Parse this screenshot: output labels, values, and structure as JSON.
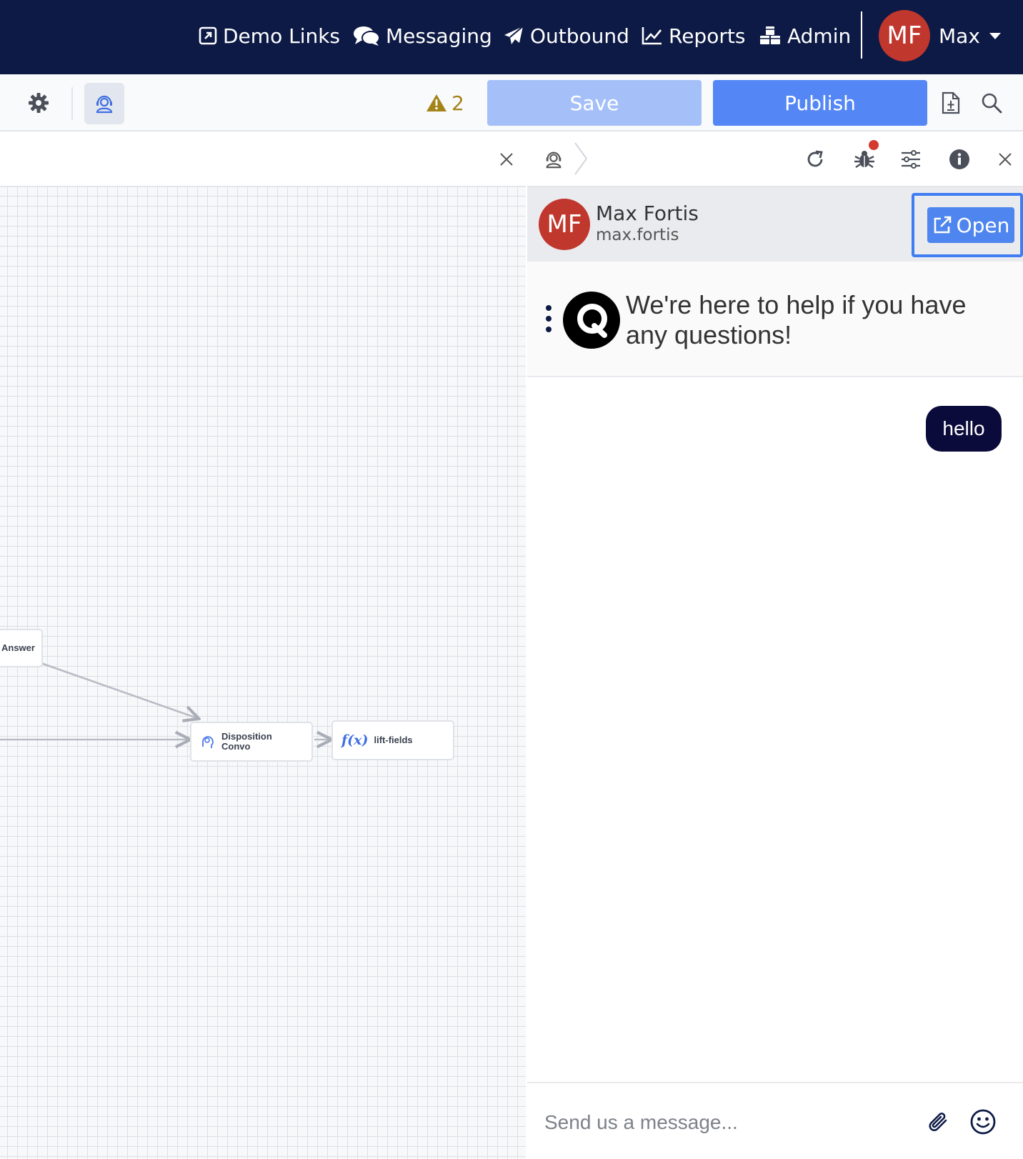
{
  "nav": {
    "items": [
      {
        "label": "Demo Links",
        "icon": "external-link-square-icon"
      },
      {
        "label": "Messaging",
        "icon": "comments-icon"
      },
      {
        "label": "Outbound",
        "icon": "paper-plane-icon"
      },
      {
        "label": "Reports",
        "icon": "line-chart-icon"
      },
      {
        "label": "Admin",
        "icon": "cubes-icon"
      }
    ],
    "avatar_initials": "MF",
    "user_label": "Max"
  },
  "toolbar": {
    "warning_count": "2",
    "save_label": "Save",
    "publish_label": "Publish"
  },
  "canvas": {
    "nodes": [
      {
        "label": "Answer"
      },
      {
        "label_line1": "Disposition",
        "label_line2": "Convo"
      },
      {
        "label": "lift-fields"
      }
    ]
  },
  "chat": {
    "user": {
      "initials": "MF",
      "name": "Max Fortis",
      "handle": "max.fortis"
    },
    "open_label": "Open",
    "welcome_text": "We're here to help if you have any questions!",
    "messages": [
      {
        "from": "user",
        "text": "hello"
      }
    ],
    "composer_placeholder": "Send us a message..."
  },
  "colors": {
    "nav_bg": "#0d1a45",
    "avatar_red": "#c0372e",
    "save_disabled": "#a5c0f8",
    "publish_blue": "#5487f5",
    "warning_gold": "#a48319",
    "bubble_navy": "#0b0b3b",
    "notification_red": "#d33a30"
  }
}
